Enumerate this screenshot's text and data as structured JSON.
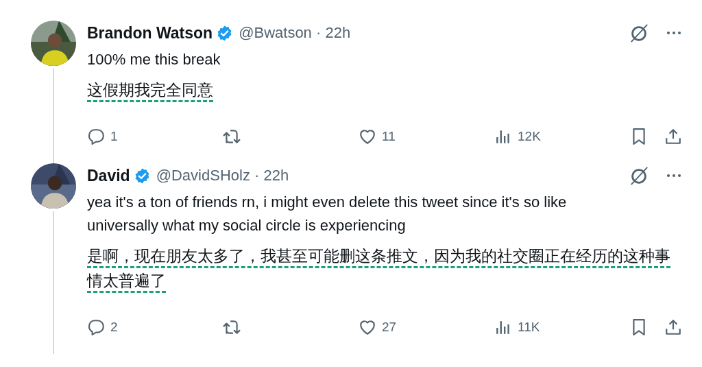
{
  "tweets": [
    {
      "name": "Brandon Watson",
      "verified": true,
      "meta": "@Bwatson · 22h",
      "text": "100% me this break",
      "translation": "这假期我完全同意",
      "replies": "1",
      "likes": "11",
      "views": "12K"
    },
    {
      "name": "David",
      "verified": true,
      "meta": "@DavidSHolz · 22h",
      "text": "yea it's a ton of friends rn, i might even delete this tweet since it's so like universally what my social circle is experiencing",
      "translation": "是啊，现在朋友太多了，我甚至可能删这条推文，因为我的社交圈正在经历的这种事情太普遍了",
      "replies": "2",
      "likes": "27",
      "views": "11K"
    }
  ]
}
